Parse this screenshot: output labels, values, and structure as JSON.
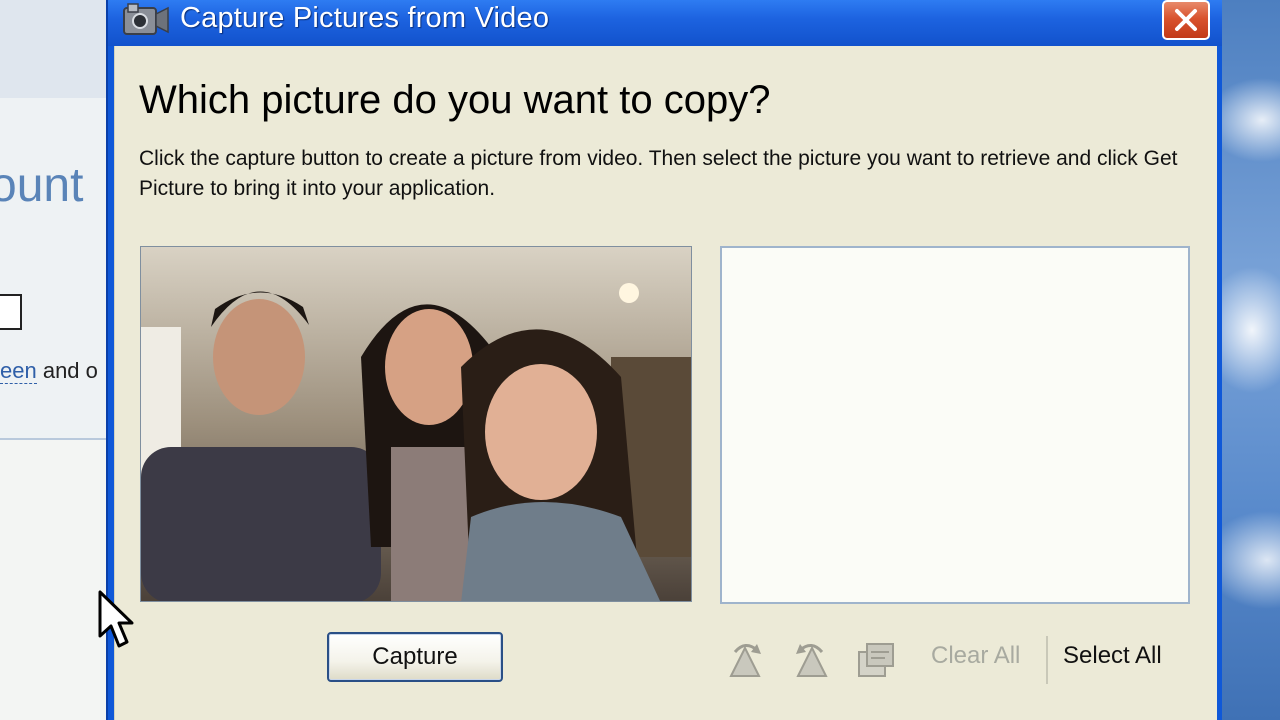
{
  "window": {
    "title": "Capture Pictures from Video",
    "close_glyph": "✕"
  },
  "dialog": {
    "heading": "Which picture do you want to copy?",
    "instructions": "Click the capture button to create a picture from video. Then select the picture you want to retrieve and click Get Picture to bring it into your application."
  },
  "buttons": {
    "capture": "Capture",
    "clear_all": "Clear All",
    "select_all": "Select All"
  },
  "toolbar_icons": [
    "rotate-right-icon",
    "rotate-left-icon",
    "properties-icon"
  ],
  "background_window": {
    "heading_fragment": "ount",
    "link_fragment": "een",
    "text_fragment": " and o"
  },
  "colors": {
    "titlebar": "#1d63e0",
    "client_bg": "#ecead7",
    "close_button": "#d9532e",
    "disabled_text": "#a8aaa0"
  }
}
